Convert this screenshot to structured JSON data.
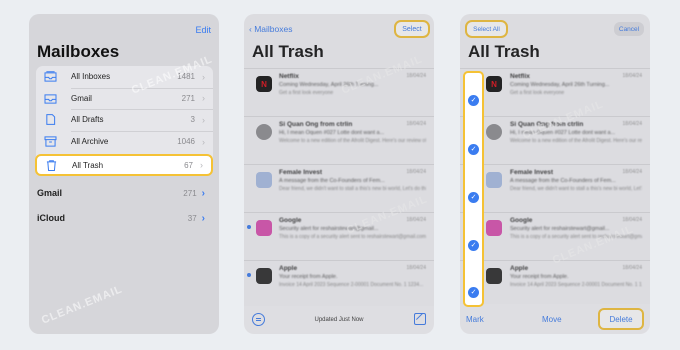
{
  "panel1": {
    "edit_label": "Edit",
    "title": "Mailboxes",
    "mailboxes": [
      {
        "label": "All Inboxes",
        "count": "1481",
        "icon": "inbox-stack-icon"
      },
      {
        "label": "Gmail",
        "count": "271",
        "icon": "inbox-icon"
      },
      {
        "label": "All Drafts",
        "count": "3",
        "icon": "document-icon"
      },
      {
        "label": "All Archive",
        "count": "1046",
        "icon": "archive-box-icon"
      },
      {
        "label": "All Trash",
        "count": "67",
        "icon": "trash-icon"
      }
    ],
    "accounts": [
      {
        "label": "Gmail",
        "count": "271"
      },
      {
        "label": "iCloud",
        "count": "37"
      }
    ]
  },
  "panel2": {
    "back_label": "Mailboxes",
    "select_label": "Select",
    "title": "All Trash",
    "status": "Updated Just Now"
  },
  "emails": [
    {
      "sender": "Netflix",
      "date": "18/04/24",
      "subject": "Coming Wednesday, April 26th Turning...",
      "preview": "Get a first look everyone",
      "icon_color": "#111111",
      "icon_letter": "N",
      "unread": false
    },
    {
      "sender": "Si Quan Ong from ctrlin",
      "date": "18/04/24",
      "subject": "Hi, I mean Oquen #027 Lotte dont want a...",
      "preview": "Welcome to a new edition of the Afrolit Digest. Here's our review of 2024",
      "icon_color": "#8e8e92",
      "icon_letter": "",
      "unread": false
    },
    {
      "sender": "Female Invest",
      "date": "18/04/24",
      "subject": "A message from the Co-Founders of Fem...",
      "preview": "Dear friend, we didn't want to stall a this's new bi world, Let's do this right...",
      "icon_color": "#a9bde4",
      "icon_letter": "",
      "unread": false
    },
    {
      "sender": "Google",
      "date": "18/04/24",
      "subject": "Security alert for reshairstewart@gmail...",
      "preview": "This is a copy of a security alert sent to reshairstewart@gmail.com address itou...",
      "icon_color": "#d94fb0",
      "icon_letter": "",
      "unread": true
    },
    {
      "sender": "Apple",
      "date": "18/04/24",
      "subject": "Your receipt from Apple.",
      "preview": "Invoice 14 April 2023 Sequence 2-00001 Document No. 1 1234...",
      "icon_color": "#2a2a2a",
      "icon_letter": "",
      "unread": true
    }
  ],
  "panel3": {
    "select_all_label": "Select All",
    "cancel_label": "Cancel",
    "title": "All Trash",
    "mark_label": "Mark",
    "move_label": "Move",
    "delete_label": "Delete"
  },
  "watermark": "CLEAN.EMAIL",
  "colors": {
    "accent": "#3a7cf0",
    "highlight": "#f5c235"
  }
}
